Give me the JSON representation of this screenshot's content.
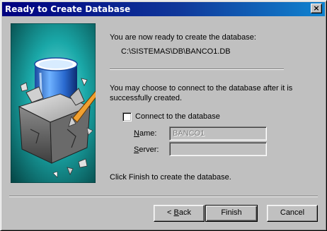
{
  "window": {
    "title": "Ready to Create Database",
    "close_glyph": "×"
  },
  "content": {
    "ready_text": "You are now ready to create the database:",
    "db_path": "C:\\SISTEMAS\\DB\\BANCO1.DB",
    "connect_text_line1": "You may choose to connect to the database after it is",
    "connect_text_line2": "successfully created.",
    "connect_checkbox_label": "Connect to the database",
    "connect_checked": false,
    "name_label_prefix": "",
    "name_label_access": "N",
    "name_label_rest": "ame:",
    "name_value": "BANCO1",
    "server_label_prefix": "",
    "server_label_access": "S",
    "server_label_rest": "erver:",
    "server_value": "",
    "finish_hint": "Click Finish to create the database."
  },
  "buttons": {
    "back_prefix": "< ",
    "back_access": "B",
    "back_rest": "ack",
    "finish": "Finish",
    "cancel": "Cancel"
  },
  "colors": {
    "titlebar_start": "#000080",
    "titlebar_end": "#1084d0",
    "dialog_face": "#c0c0c0",
    "art_teal": "#0f8080"
  }
}
